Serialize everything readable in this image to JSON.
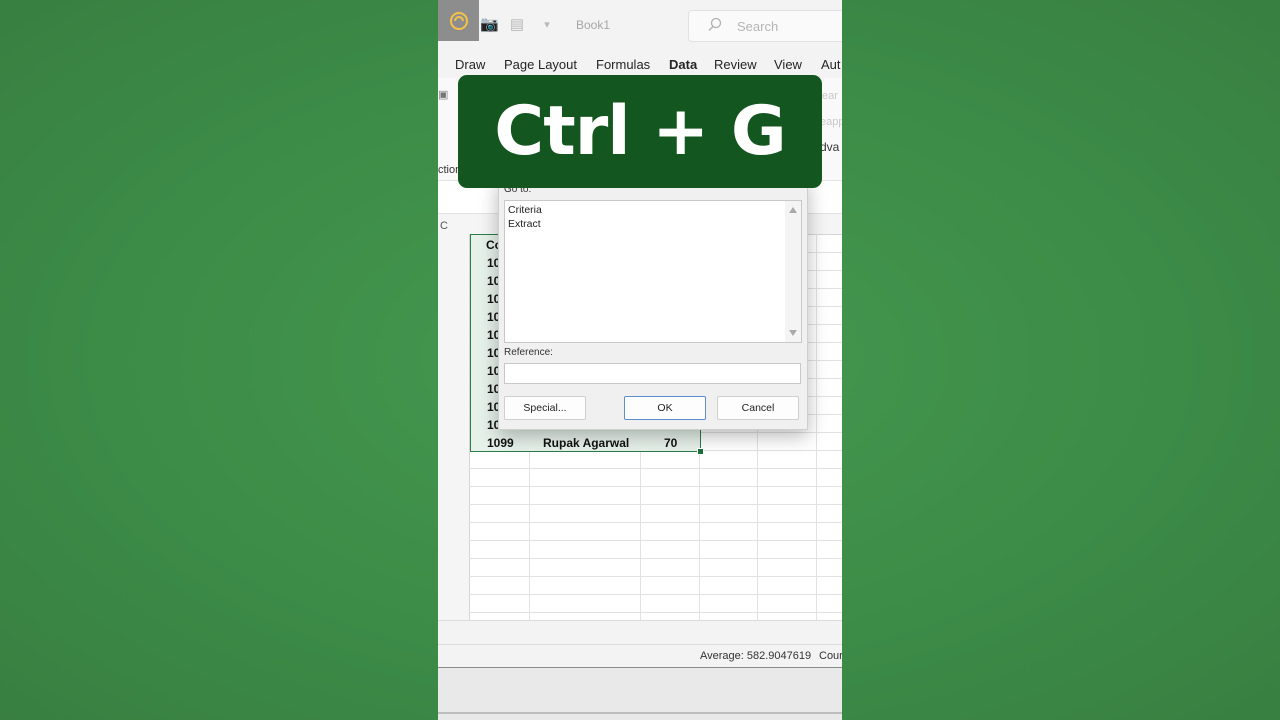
{
  "window": {
    "title": "Book1",
    "search_placeholder": "Search"
  },
  "ribbon_tabs": [
    "Draw",
    "Page Layout",
    "Formulas",
    "Data",
    "Review",
    "View",
    "Aut"
  ],
  "ribbon_active_tab": "Data",
  "ribbon_fragments": {
    "left_bottom": "ction",
    "right_1": "ear",
    "right_2": "eapp",
    "right_3": "dva"
  },
  "column_header_visible": "C",
  "sheet": {
    "col_header_partial": "Co",
    "row_prefixes": [
      "10",
      "10",
      "10",
      "10",
      "10",
      "10",
      "10",
      "10",
      "10",
      "10"
    ],
    "last_row": {
      "id": "1099",
      "name": "Rupak Agarwal",
      "score": "70"
    }
  },
  "dialog": {
    "goto_label": "Go to:",
    "goto_items": [
      "Criteria",
      "Extract"
    ],
    "reference_label": "Reference:",
    "reference_value": "",
    "buttons": {
      "special": "Special...",
      "ok": "OK",
      "cancel": "Cancel"
    }
  },
  "status": {
    "average": "Average: 582.9047619",
    "count": "Cour"
  },
  "banner": {
    "text": "Ctrl + G"
  },
  "colors": {
    "background": "#3f8f4a",
    "banner": "#14561f",
    "excel_accent": "#1d6f3b"
  }
}
